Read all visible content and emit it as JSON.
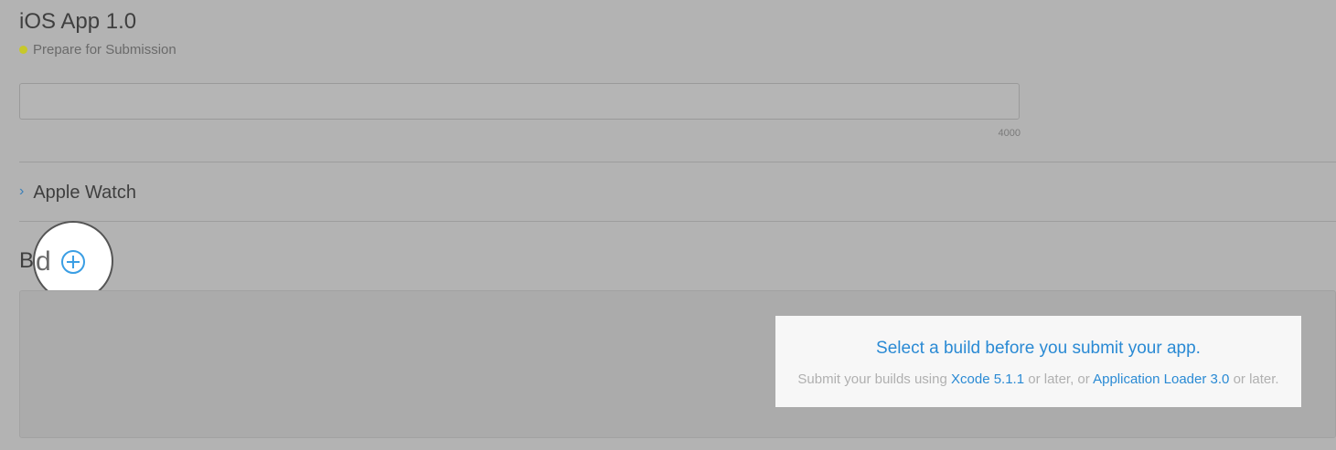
{
  "app": {
    "title": "iOS App 1.0",
    "status": "Prepare for Submission",
    "status_color": "#c7c82a"
  },
  "description_field": {
    "value": "",
    "char_limit": "4000"
  },
  "sections": {
    "apple_watch_label": "Apple Watch",
    "build_label_visible": "Bu",
    "build_label_in_spotlight": "d"
  },
  "build_message": {
    "title": "Select a build before you submit your app.",
    "sub_prefix": "Submit your builds using",
    "xcode_link": "Xcode 5.1.1",
    "sub_middle": "or later, or",
    "loader_link": "Application Loader 3.0",
    "sub_suffix": "or later."
  },
  "colors": {
    "accent": "#2a8ad4",
    "overlay": "#b3b3b3"
  },
  "icons": {
    "add_build": "plus-circle-icon",
    "expand": "chevron-right-icon"
  }
}
